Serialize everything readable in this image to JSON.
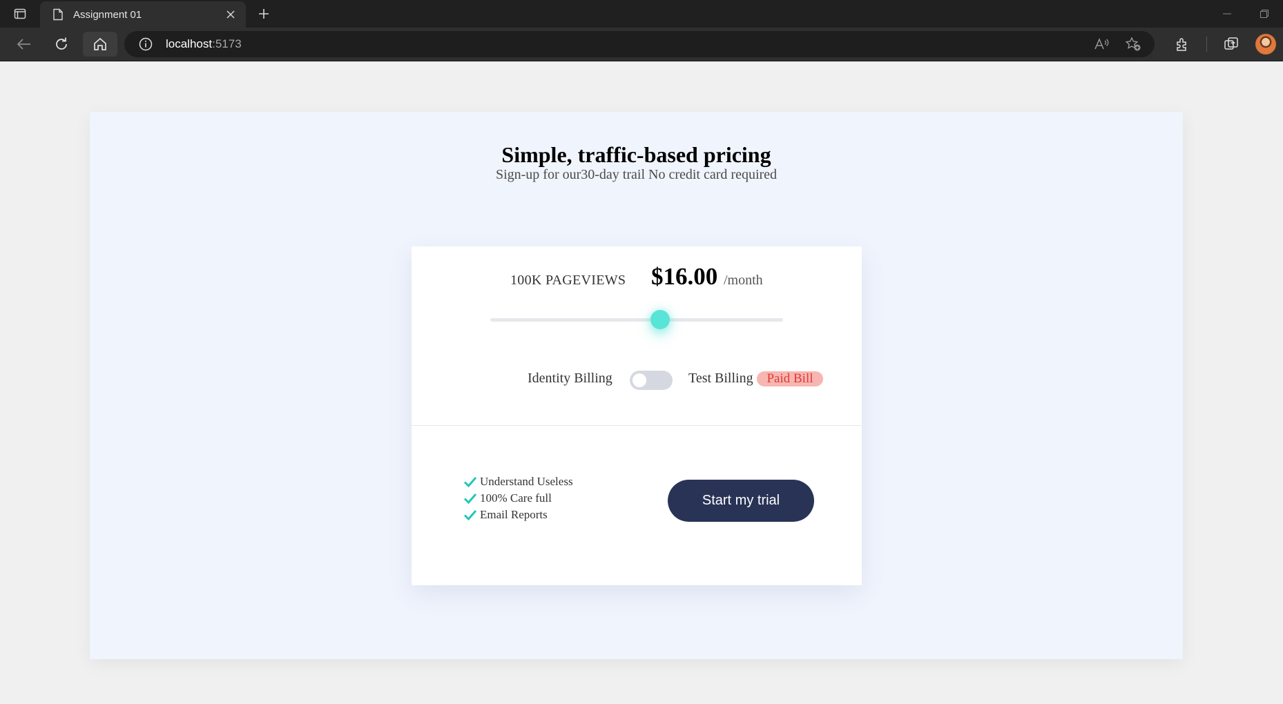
{
  "browser": {
    "tab_title": "Assignment 01",
    "url_host": "localhost",
    "url_port": ":5173"
  },
  "page": {
    "title": "Simple, traffic-based pricing",
    "subtitle": "Sign-up for our30-day trail No credit card required"
  },
  "pricing": {
    "pageviews_label": "100K PAGEVIEWS",
    "price": "$16.00",
    "period": "/month",
    "slider_value_fraction": 0.58,
    "accent_color": "#58e4d6"
  },
  "billing": {
    "left_label": "Identity Billing",
    "right_label": "Test Billing",
    "badge": "Paid Bill",
    "toggle_on": false
  },
  "features": [
    {
      "text": "Understand Useless",
      "icon": "check-icon"
    },
    {
      "text": "100% Care full",
      "icon": "check-icon"
    },
    {
      "text": "Email Reports",
      "icon": "check-icon"
    }
  ],
  "cta": {
    "label": "Start my trial",
    "color": "#293356"
  }
}
